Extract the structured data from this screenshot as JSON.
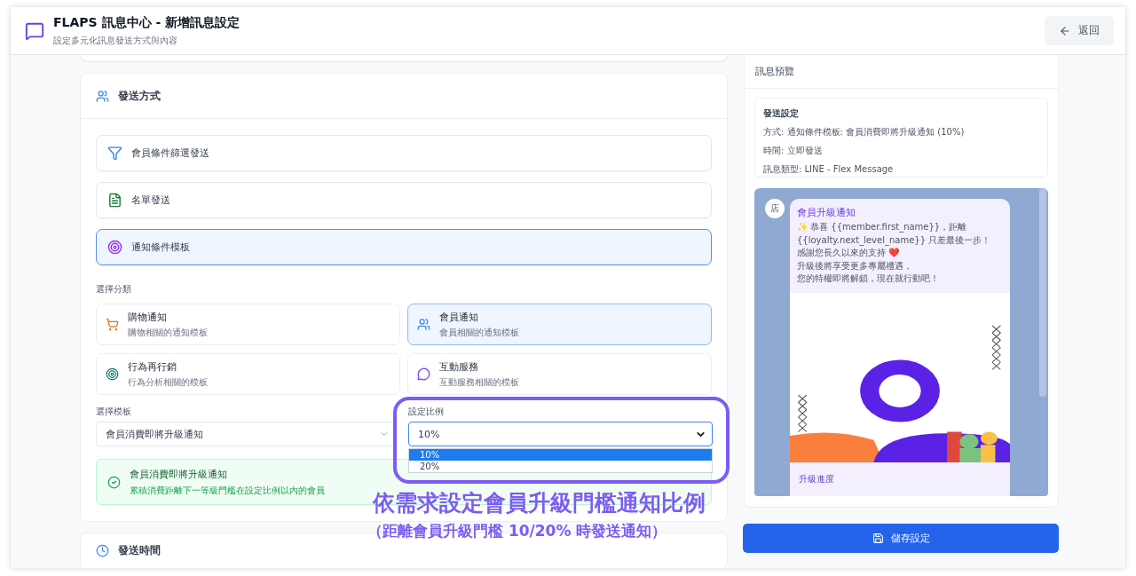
{
  "header": {
    "title": "FLAPS 訊息中心 - 新增訊息設定",
    "subtitle": "設定多元化訊息發送方式與內容",
    "back_button": "返回"
  },
  "send_method": {
    "title": "發送方式",
    "options": [
      {
        "label": "會員條件篩選發送",
        "kind": "filter",
        "selected": false
      },
      {
        "label": "名單發送",
        "kind": "list",
        "selected": false
      },
      {
        "label": "通知條件模板",
        "kind": "template",
        "selected": true
      }
    ],
    "category_label": "選擇分類",
    "categories": [
      {
        "title": "購物通知",
        "description": "購物相關的通知模板",
        "kind": "cart",
        "selected": false
      },
      {
        "title": "會員通知",
        "description": "會員相關的通知模板",
        "kind": "members",
        "selected": true
      },
      {
        "title": "行為再行銷",
        "description": "行為分析相關的模板",
        "kind": "target",
        "selected": false
      },
      {
        "title": "互動服務",
        "description": "互動服務相關的模板",
        "kind": "chat",
        "selected": false
      }
    ],
    "template_label": "選擇模板",
    "template_value": "會員消費即將升級通知",
    "ratio_label": "設定比例",
    "ratio_value": "10%",
    "ratio_options": [
      {
        "label": "10%",
        "selected": true
      },
      {
        "label": "20%",
        "selected": false
      }
    ],
    "chosen": {
      "title": "會員消費即將升級通知",
      "description": "累積消費距離下一等級門檻在設定比例以內的會員"
    }
  },
  "send_time": {
    "title": "發送時間"
  },
  "preview": {
    "title": "訊息預覽",
    "settings_title": "發送設定",
    "settings": [
      "方式: 通知條件模板: 會員消費即將升級通知 (10%)",
      "時間: 立即發送",
      "訊息類型: LINE - Flex Message"
    ],
    "avatar": "店",
    "bubble_title": "會員升級通知",
    "bubble_lines": [
      "✨ 恭喜 {{member.first_name}}，距離",
      "{{loyalty.next_level_name}} 只差最後一步！",
      "感謝您長久以來的支持 ❤️",
      "升級後將享受更多專屬禮遇，",
      "您的特權即將解鎖，現在就行動吧！"
    ],
    "progress_title": "升級進度"
  },
  "save_button": "儲存設定",
  "annotation": {
    "headline": "依需求設定會員升級門檻通知比例",
    "note": "（距離會員升級門檻 10/20% 時發送通知）"
  }
}
